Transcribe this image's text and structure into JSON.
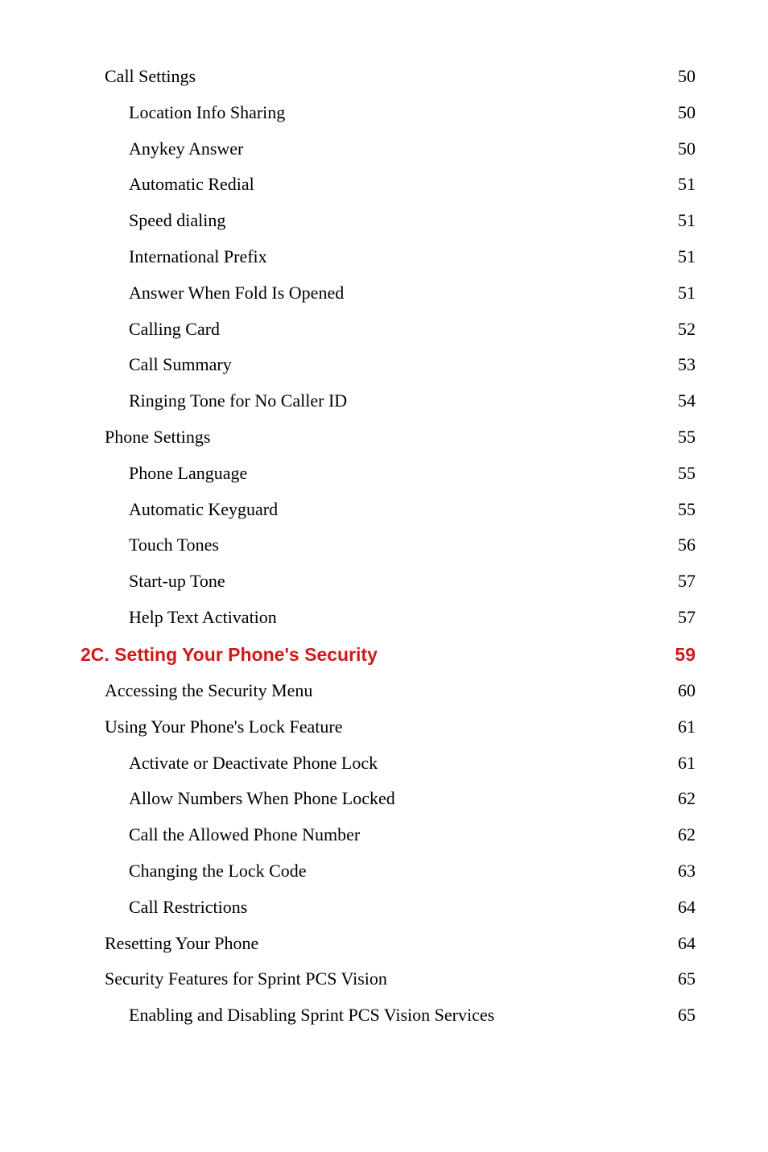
{
  "entries": [
    {
      "label": "Call Settings",
      "page": "50",
      "level": 1
    },
    {
      "label": "Location Info Sharing",
      "page": "50",
      "level": 2
    },
    {
      "label": "Anykey Answer",
      "page": "50",
      "level": 2
    },
    {
      "label": "Automatic Redial",
      "page": "51",
      "level": 2
    },
    {
      "label": "Speed dialing",
      "page": "51",
      "level": 2
    },
    {
      "label": "International Prefix",
      "page": "51",
      "level": 2
    },
    {
      "label": "Answer When Fold Is Opened",
      "page": "51",
      "level": 2
    },
    {
      "label": "Calling Card",
      "page": "52",
      "level": 2
    },
    {
      "label": "Call Summary",
      "page": "53",
      "level": 2
    },
    {
      "label": "Ringing Tone for No Caller ID",
      "page": "54",
      "level": 2
    },
    {
      "label": "Phone Settings",
      "page": "55",
      "level": 1
    },
    {
      "label": "Phone Language",
      "page": "55",
      "level": 2
    },
    {
      "label": "Automatic Keyguard",
      "page": "55",
      "level": 2
    },
    {
      "label": "Touch Tones",
      "page": "56",
      "level": 2
    },
    {
      "label": "Start-up Tone",
      "page": "57",
      "level": 2
    },
    {
      "label": "Help Text Activation",
      "page": "57",
      "level": 2
    },
    {
      "label": "2C. Setting Your Phone's Security",
      "page": " 59",
      "level": "section"
    },
    {
      "label": "Accessing the Security Menu",
      "page": "60",
      "level": 1
    },
    {
      "label": "Using Your Phone's Lock Feature",
      "page": "61",
      "level": 1
    },
    {
      "label": "Activate or Deactivate Phone Lock",
      "page": "61",
      "level": 2
    },
    {
      "label": "Allow Numbers When Phone Locked",
      "page": "62",
      "level": 2
    },
    {
      "label": "Call the Allowed Phone Number",
      "page": "62",
      "level": 2
    },
    {
      "label": "Changing the Lock Code",
      "page": "63",
      "level": 2
    },
    {
      "label": "Call Restrictions",
      "page": "64",
      "level": 2
    },
    {
      "label": "Resetting Your Phone",
      "page": "64",
      "level": 1
    },
    {
      "label": "Security Features for Sprint PCS Vision",
      "page": "65",
      "level": 1
    },
    {
      "label": "Enabling and Disabling Sprint PCS Vision Services",
      "page": "65",
      "level": 2
    }
  ]
}
